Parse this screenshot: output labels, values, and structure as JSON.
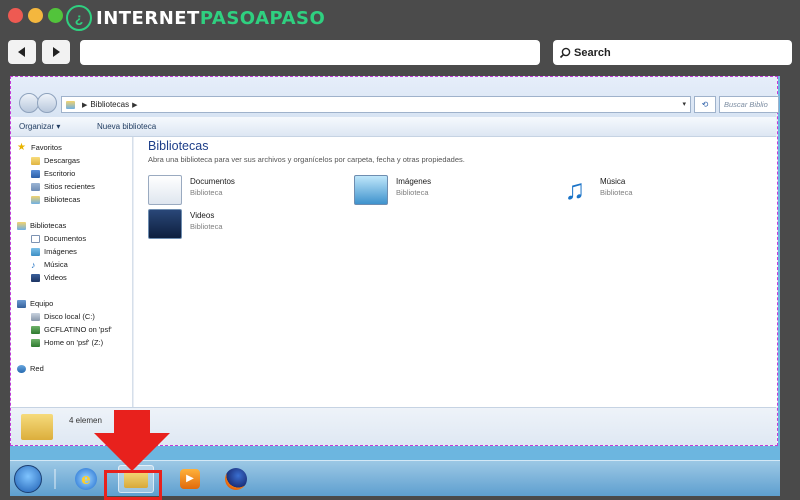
{
  "site": {
    "logo_prefix": "INTERNET",
    "logo_suffix": "PASOAPASO",
    "logo_mark": "¿"
  },
  "browser": {
    "back_icon": "back-arrow-icon",
    "forward_icon": "forward-arrow-icon",
    "url": "",
    "search_label": "Search"
  },
  "explorer": {
    "breadcrumb": [
      "Bibliotecas"
    ],
    "search_placeholder": "Buscar Biblio",
    "toolbar": {
      "organize": "Organizar ▾",
      "new_library": "Nueva biblioteca"
    },
    "nav": {
      "favorites": "Favoritos",
      "favorites_items": [
        "Descargas",
        "Escritorio",
        "Sitios recientes",
        "Bibliotecas"
      ],
      "libraries": "Bibliotecas",
      "libraries_items": [
        "Documentos",
        "Imágenes",
        "Música",
        "Videos"
      ],
      "computer": "Equipo",
      "computer_items": [
        "Disco local (C:)",
        "GCFLATINO on 'psf'",
        "Home on 'psf' (Z:)"
      ],
      "network": "Red"
    },
    "content": {
      "title": "Bibliotecas",
      "subtitle": "Abra una biblioteca para ver sus archivos y organícelos por carpeta, fecha y otras propiedades.",
      "items": [
        {
          "name": "Documentos",
          "type": "Biblioteca"
        },
        {
          "name": "Imágenes",
          "type": "Biblioteca"
        },
        {
          "name": "Música",
          "type": "Biblioteca"
        },
        {
          "name": "Videos",
          "type": "Biblioteca"
        }
      ]
    },
    "status": "4 elemen"
  },
  "taskbar": {
    "ie_glyph": "e",
    "media_glyph": "▶"
  },
  "colors": {
    "annotation": "#e8211d",
    "logo_green": "#2fd080",
    "selection_border": "#c23bd8"
  }
}
